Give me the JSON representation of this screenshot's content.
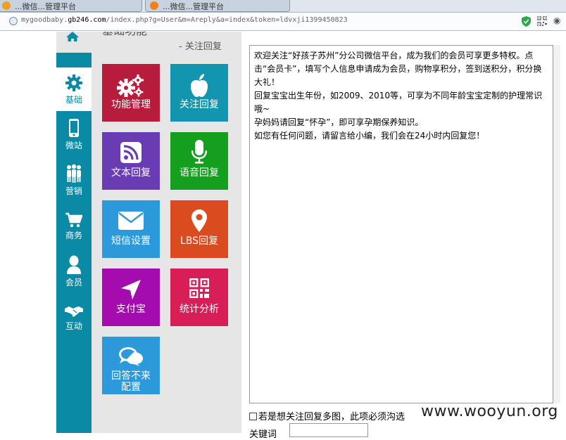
{
  "browser": {
    "tabs": [
      {
        "label": "...微信...管理平台",
        "color": "#f0a020"
      },
      {
        "label": "...微信...管理平台",
        "color": "#f08020"
      }
    ],
    "url_prefix": "mygoodbaby.",
    "url_host": "gb246.com",
    "url_path": "/index.php?g=User&m=Areply&a=index&token=ldvxji1399450823"
  },
  "header": {
    "title": "基础功能",
    "subtitle": "- 关注回复"
  },
  "sidebar": {
    "items": [
      {
        "label": "基础",
        "icon": "gear-icon",
        "active": true
      },
      {
        "label": "微站",
        "icon": "mobile-icon",
        "active": false
      },
      {
        "label": "营销",
        "icon": "people-icon",
        "active": false
      },
      {
        "label": "商务",
        "icon": "cart-icon",
        "active": false
      },
      {
        "label": "会员",
        "icon": "user-icon",
        "active": false
      },
      {
        "label": "互动",
        "icon": "handshake-icon",
        "active": false
      }
    ]
  },
  "tiles": [
    {
      "label": "功能管理",
      "icon": "gears-icon",
      "color": "#b71c3c"
    },
    {
      "label": "关注回复",
      "icon": "apple-icon",
      "color": "#1296b0"
    },
    {
      "label": "文本回复",
      "icon": "rss-icon",
      "color": "#6a3cb4"
    },
    {
      "label": "语音回复",
      "icon": "microphone-icon",
      "color": "#14a01e"
    },
    {
      "label": "短信设置",
      "icon": "envelope-icon",
      "color": "#2c9ada"
    },
    {
      "label": "LBS回复",
      "icon": "map-pin-icon",
      "color": "#da4c20"
    },
    {
      "label": "支付宝",
      "icon": "location-arrow-icon",
      "color": "#a40cb0"
    },
    {
      "label": "统计分析",
      "icon": "qrcode-icon",
      "color": "#d81e56"
    },
    {
      "label_line1": "回答不来",
      "label_line2": "配置",
      "icon": "chat-bubbles-icon",
      "color": "#2c9ada"
    }
  ],
  "editor": {
    "lines": [
      "欢迎关注“好孩子苏州”分公司微信平台，成为我们的会员可享更多特权。点击“会员卡”，填写个人信息申请成为会员，购物享积分，签到送积分，积分换大礼！",
      "回复宝宝出生年份，如2009、2010等，可享为不同年龄宝宝定制的护理常识哦~",
      "孕妈妈请回复“怀孕”，即可享孕期保养知识。",
      "如您有任何问题，请留言给小编，我们会在24小时内回复您！"
    ]
  },
  "form": {
    "checkbox_label": "若是想关注回复多图，此项必须沟选",
    "keyword_label": "关键词",
    "keyword_value": ""
  },
  "watermark": "www.wooyun.org"
}
